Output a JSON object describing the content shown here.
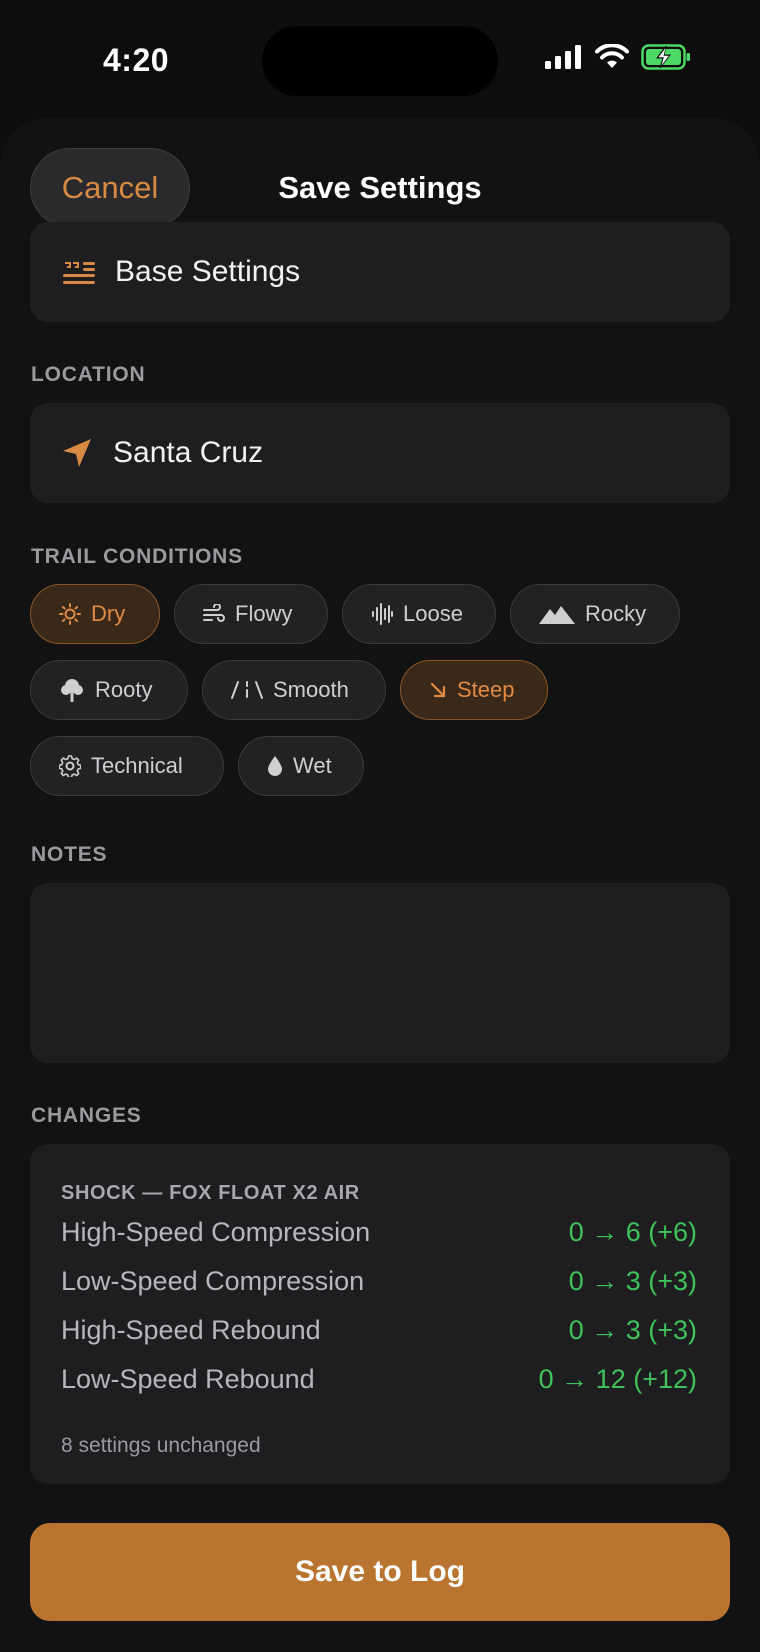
{
  "status_bar": {
    "time": "4:20"
  },
  "nav": {
    "cancel_label": "Cancel",
    "title": "Save Settings"
  },
  "base_settings": {
    "label": "Base Settings",
    "icon": "list-quote-icon"
  },
  "location": {
    "section_label": "LOCATION",
    "value": "Santa Cruz",
    "icon": "location-arrow-icon"
  },
  "trail_conditions": {
    "section_label": "TRAIL CONDITIONS",
    "chips": [
      {
        "label": "Dry",
        "icon": "sun-icon",
        "selected": true
      },
      {
        "label": "Flowy",
        "icon": "wind-icon",
        "selected": false
      },
      {
        "label": "Loose",
        "icon": "waveform-icon",
        "selected": false
      },
      {
        "label": "Rocky",
        "icon": "mountain-icon",
        "selected": false
      },
      {
        "label": "Rooty",
        "icon": "tree-icon",
        "selected": false
      },
      {
        "label": "Smooth",
        "icon": "road-icon",
        "selected": false
      },
      {
        "label": "Steep",
        "icon": "arrow-down-right-icon",
        "selected": true
      },
      {
        "label": "Technical",
        "icon": "gear-icon",
        "selected": false
      },
      {
        "label": "Wet",
        "icon": "drop-icon",
        "selected": false
      }
    ]
  },
  "notes": {
    "section_label": "NOTES",
    "value": ""
  },
  "changes": {
    "section_label": "CHANGES",
    "group_title": "SHOCK — FOX FLOAT X2 AIR",
    "rows": [
      {
        "name": "High-Speed Compression",
        "value": "0 → 6 (+6)"
      },
      {
        "name": "Low-Speed Compression",
        "value": "0 → 3 (+3)"
      },
      {
        "name": "High-Speed Rebound",
        "value": "0 → 3 (+3)"
      },
      {
        "name": "Low-Speed Rebound",
        "value": "0 → 12 (+12)"
      }
    ],
    "unchanged_note": "8 settings unchanged"
  },
  "save_button": {
    "label": "Save to Log"
  },
  "colors": {
    "accent": "#d88a45",
    "positive": "#3fc259",
    "button": "#b97430",
    "battery": "#4cd964"
  }
}
